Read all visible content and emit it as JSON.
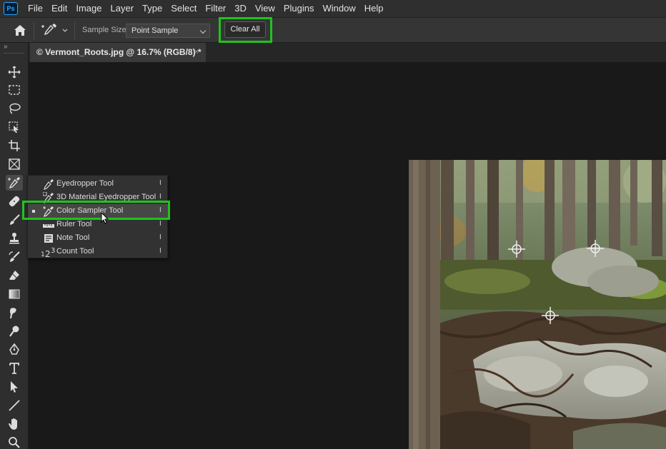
{
  "menubar": {
    "logo": "Ps",
    "items": [
      "File",
      "Edit",
      "Image",
      "Layer",
      "Type",
      "Select",
      "Filter",
      "3D",
      "View",
      "Plugins",
      "Window",
      "Help"
    ]
  },
  "options": {
    "sample_size_label": "Sample Size:",
    "sample_size_value": "Point Sample",
    "clear_all_label": "Clear All"
  },
  "document": {
    "tab_title": "© Vermont_Roots.jpg @ 16.7% (RGB/8) *",
    "tab_close": "×"
  },
  "toolbar": {
    "collapse": "»"
  },
  "flyout": {
    "items": [
      {
        "label": "Eyedropper Tool",
        "key": "I",
        "icon": "eyedropper-icon"
      },
      {
        "label": "3D Material Eyedropper Tool",
        "key": "I",
        "icon": "3d-eyedropper-icon"
      },
      {
        "label": "Color Sampler Tool",
        "key": "I",
        "icon": "color-sampler-icon"
      },
      {
        "label": "Ruler Tool",
        "key": "I",
        "icon": "ruler-icon"
      },
      {
        "label": "Note Tool",
        "key": "I",
        "icon": "note-icon"
      },
      {
        "label": "Count Tool",
        "key": "I",
        "icon": "count-icon"
      }
    ],
    "selected_index": 2
  },
  "colors": {
    "highlight": "#21c21e",
    "ps_blue": "#31a8ff"
  }
}
